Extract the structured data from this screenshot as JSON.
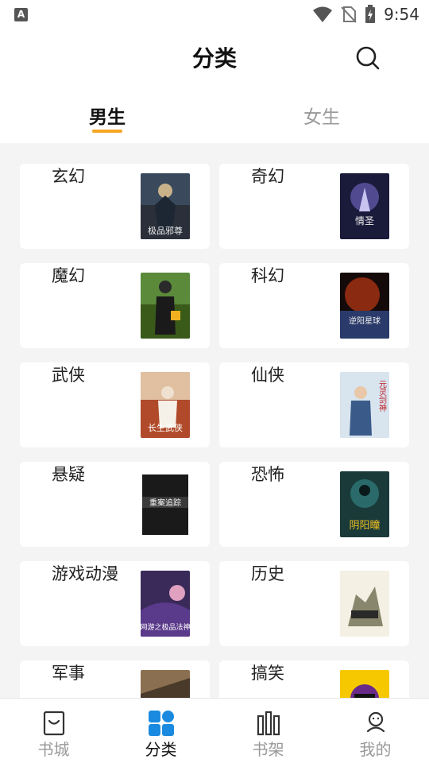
{
  "status_bar": {
    "time": "9:54",
    "app_badge": "A"
  },
  "header": {
    "title": "分类",
    "search_icon": "search-icon"
  },
  "tabs": [
    {
      "label": "男生",
      "active": true
    },
    {
      "label": "女生",
      "active": false
    }
  ],
  "accent_color": "#f5a623",
  "categories": [
    {
      "label": "玄幻",
      "cover_text": "极品邪尊"
    },
    {
      "label": "奇幻",
      "cover_text": "情圣"
    },
    {
      "label": "魔幻",
      "cover_text": ""
    },
    {
      "label": "科幻",
      "cover_text": "逆阳星球"
    },
    {
      "label": "武侠",
      "cover_text": "长生武侠"
    },
    {
      "label": "仙侠",
      "cover_text": "元灵剑神"
    },
    {
      "label": "悬疑",
      "cover_text": "重案追踪"
    },
    {
      "label": "恐怖",
      "cover_text": "阴阳瞳"
    },
    {
      "label": "游戏动漫",
      "cover_text": "网游之极品法神"
    },
    {
      "label": "历史",
      "cover_text": ""
    },
    {
      "label": "军事",
      "cover_text": ""
    },
    {
      "label": "搞笑",
      "cover_text": ""
    }
  ],
  "bottom_nav": [
    {
      "label": "书城",
      "icon": "bag-icon",
      "active": false
    },
    {
      "label": "分类",
      "icon": "grid-icon",
      "active": true
    },
    {
      "label": "书架",
      "icon": "bookshelf-icon",
      "active": false
    },
    {
      "label": "我的",
      "icon": "user-icon",
      "active": false
    }
  ]
}
